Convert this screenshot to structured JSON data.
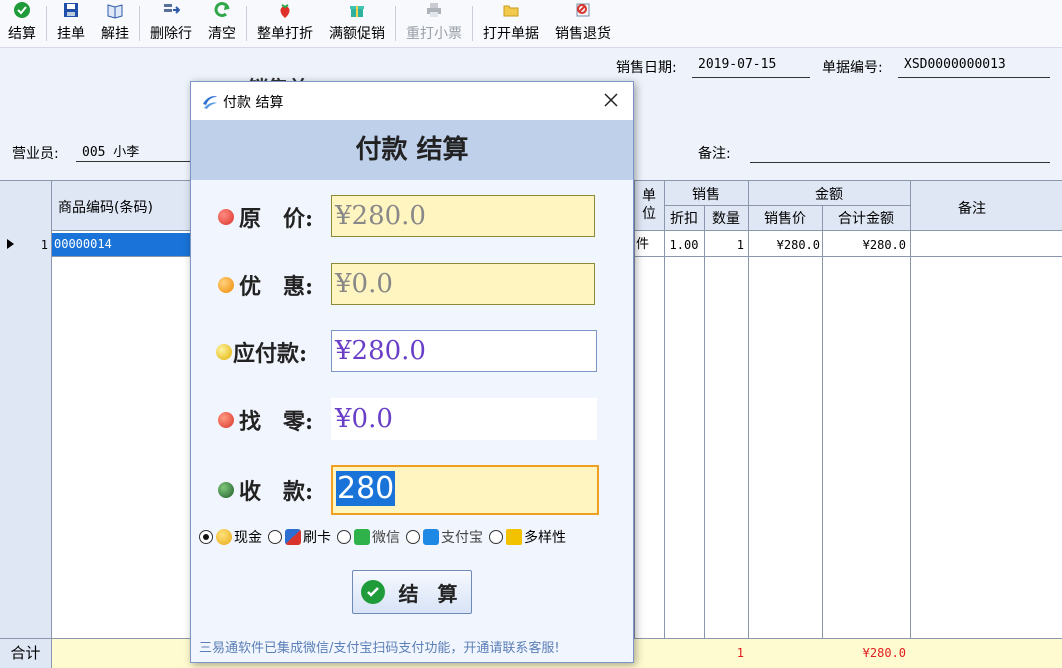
{
  "toolbar": {
    "buttons": [
      {
        "label": "结算",
        "icon": "check-circle-icon",
        "enabled": true
      },
      {
        "label": "挂单",
        "icon": "save-disk-icon",
        "enabled": true
      },
      {
        "label": "解挂",
        "icon": "open-book-icon",
        "enabled": true
      },
      {
        "label": "删除行",
        "icon": "delete-row-icon",
        "enabled": true
      },
      {
        "label": "清空",
        "icon": "refresh-icon",
        "enabled": true
      },
      {
        "label": "整单打折",
        "icon": "strawberry-icon",
        "enabled": true
      },
      {
        "label": "满额促销",
        "icon": "gift-box-icon",
        "enabled": true
      },
      {
        "label": "重打小票",
        "icon": "printer-icon",
        "enabled": false
      },
      {
        "label": "打开单据",
        "icon": "folder-icon",
        "enabled": true
      },
      {
        "label": "销售退货",
        "icon": "return-icon",
        "enabled": true
      }
    ]
  },
  "header": {
    "bg_title": "销售单",
    "date_label": "销售日期:",
    "date_value": "2019-07-15",
    "doc_no_label": "单据编号:",
    "doc_no_value": "XSD0000000013",
    "clerk_label": "营业员:",
    "clerk_value": "005 小李",
    "remark_label": "备注:",
    "remark_value": ""
  },
  "grid": {
    "headers": {
      "code": "商品编码(条码)",
      "unit": "单位",
      "sales_group": "销售",
      "discount": "折扣",
      "qty": "数量",
      "amount_group": "金额",
      "price": "销售价",
      "total": "合计金额",
      "remark": "备注"
    },
    "rows": [
      {
        "num": "1",
        "code": "00000014",
        "unit": "件",
        "discount": "1.00",
        "qty": "1",
        "price": "¥280.0",
        "total": "¥280.0",
        "remark": ""
      }
    ],
    "footer": {
      "label": "合计",
      "qty_total": "1",
      "amount_total": "¥280.0"
    }
  },
  "dialog": {
    "window_title": "付款 结算",
    "banner": "付款 结算",
    "original_label": "原　价:",
    "original_value": "¥280.0",
    "discount_label": "优　惠:",
    "discount_value": "¥0.0",
    "payable_label": "应付款:",
    "payable_value": "¥280.0",
    "change_label": "找　零:",
    "change_value": "¥0.0",
    "received_label": "收　款:",
    "received_value": "280",
    "methods": [
      {
        "label": "现金",
        "selected": true,
        "color": "#e6a817"
      },
      {
        "label": "刷卡",
        "selected": false,
        "color": "#d9342b"
      },
      {
        "label": "微信",
        "selected": false,
        "color": "#2fb24a"
      },
      {
        "label": "支付宝",
        "selected": false,
        "color": "#1e88e5"
      },
      {
        "label": "多样性",
        "selected": false,
        "color": "#f2c200"
      }
    ],
    "settle_button": "结 算",
    "note": "三易通软件已集成微信/支付宝扫码支付功能，开通请联系客服!"
  },
  "colors": {
    "accent_selection": "#1a73d8",
    "banner_bg": "#bfd0ea",
    "received_bg": "#fff5c0",
    "received_border": "#f0a020",
    "footer_bg": "#fffbd0",
    "total_red": "#e02020"
  }
}
